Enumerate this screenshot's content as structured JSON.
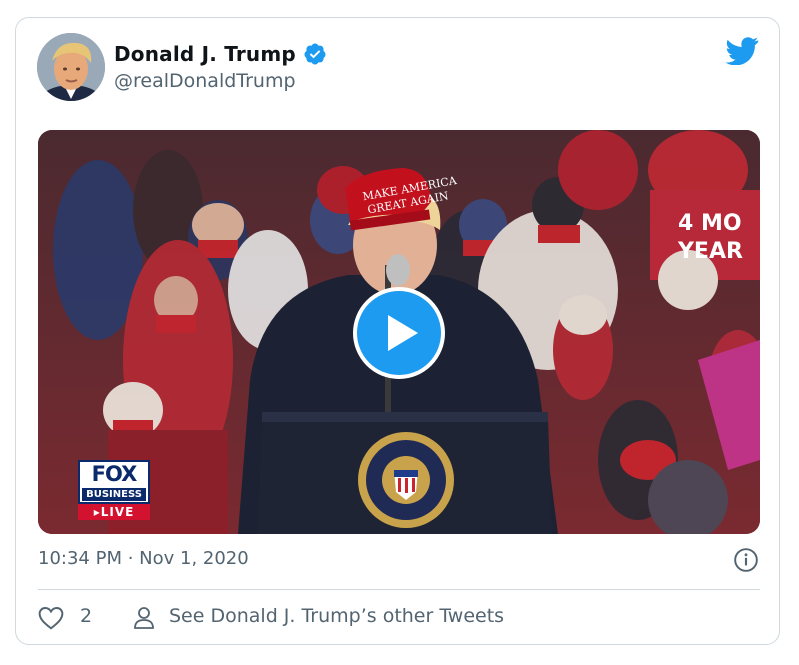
{
  "tweet": {
    "display_name": "Donald J. Trump",
    "handle": "@realDonaldTrump",
    "timestamp": "10:34 PM · Nov 1, 2020",
    "likes": "2",
    "see_more_label": "See Donald J. Trump’s other Tweets"
  },
  "media": {
    "type": "video",
    "hat_text_line1": "MAKE AMERICA",
    "hat_text_line2": "GREAT AGAIN",
    "sign_text_line1": "4 MO",
    "sign_text_line2": "YEAR",
    "network_logo": "FOX",
    "network_sub": "BUSINESS",
    "live_badge": "▸LIVE"
  },
  "colors": {
    "accent": "#1d9bf0",
    "secondary_text": "#536471",
    "border": "#cfd9de",
    "live_red": "#d2122e"
  },
  "icons": {
    "verified": "verified-badge-icon",
    "brand": "twitter-bird-icon",
    "play": "play-icon",
    "info": "info-icon",
    "like": "heart-icon",
    "profile": "person-icon"
  }
}
